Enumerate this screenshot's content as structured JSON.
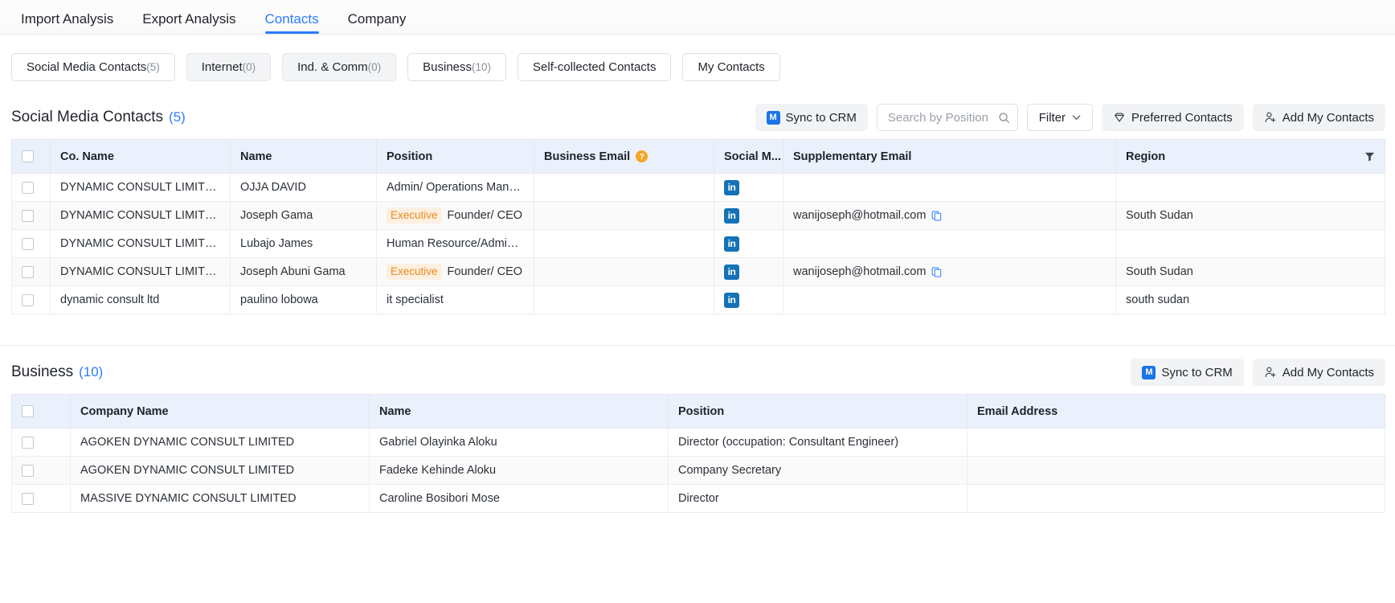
{
  "topnav": {
    "items": [
      {
        "label": "Import Analysis",
        "active": false
      },
      {
        "label": "Export Analysis",
        "active": false
      },
      {
        "label": "Contacts",
        "active": true
      },
      {
        "label": "Company",
        "active": false
      }
    ]
  },
  "chips": [
    {
      "label": "Social Media Contacts",
      "count": "(5)",
      "muted": false
    },
    {
      "label": "Internet",
      "count": "(0)",
      "muted": true
    },
    {
      "label": "Ind. & Comm",
      "count": "(0)",
      "muted": true
    },
    {
      "label": "Business",
      "count": "(10)",
      "muted": false
    },
    {
      "label": "Self-collected Contacts",
      "count": "",
      "muted": false
    },
    {
      "label": "My Contacts",
      "count": "",
      "muted": false
    }
  ],
  "social_section": {
    "title": "Social Media Contacts",
    "count": "(5)",
    "sync_label": "Sync to CRM",
    "sync_icon": "crm-icon",
    "search_placeholder": "Search by Position",
    "search_value": "",
    "search_icon": "search-icon",
    "filter_label": "Filter",
    "filter_icon": "chevron-down-icon",
    "preferred_label": "Preferred Contacts",
    "preferred_icon": "diamond-icon",
    "add_label": "Add My Contacts",
    "add_icon": "add-user-icon",
    "columns": [
      "Co. Name",
      "Name",
      "Position",
      "Business Email",
      "Social M...",
      "Supplementary Email",
      "Region"
    ],
    "business_email_help_icon": "question-icon",
    "region_filter_icon": "funnel-icon",
    "rows": [
      {
        "company": "DYNAMIC CONSULT LIMITED",
        "name": "OJJA DAVID",
        "tag": "",
        "position": "Admin/ Operations Manager",
        "business_email": "",
        "social": "linkedin-icon",
        "supplementary_email": "",
        "region": ""
      },
      {
        "company": "DYNAMIC CONSULT LIMITED",
        "name": "Joseph Gama",
        "tag": "Executive",
        "position": "Founder/ CEO",
        "business_email": "",
        "social": "linkedin-icon",
        "supplementary_email": "wanijoseph@hotmail.com",
        "region": "South Sudan"
      },
      {
        "company": "DYNAMIC CONSULT LIMITED",
        "name": "Lubajo James",
        "tag": "",
        "position": "Human Resource/Admin Of...",
        "business_email": "",
        "social": "linkedin-icon",
        "supplementary_email": "",
        "region": ""
      },
      {
        "company": "DYNAMIC CONSULT LIMITED",
        "name": "Joseph Abuni Gama",
        "tag": "Executive",
        "position": "Founder/ CEO",
        "business_email": "",
        "social": "linkedin-icon",
        "supplementary_email": "wanijoseph@hotmail.com",
        "region": "South Sudan"
      },
      {
        "company": "dynamic consult ltd",
        "name": "paulino lobowa",
        "tag": "",
        "position": "it specialist",
        "business_email": "",
        "social": "linkedin-icon",
        "supplementary_email": "",
        "region": "south sudan"
      }
    ]
  },
  "business_section": {
    "title": "Business",
    "count": "(10)",
    "sync_label": "Sync to CRM",
    "sync_icon": "crm-icon",
    "add_label": "Add My Contacts",
    "add_icon": "add-user-icon",
    "columns": [
      "Company Name",
      "Name",
      "Position",
      "Email Address"
    ],
    "rows": [
      {
        "company": "AGOKEN DYNAMIC CONSULT LIMITED",
        "name": "Gabriel Olayinka Aloku",
        "position": "Director (occupation: Consultant Engineer)",
        "email": ""
      },
      {
        "company": "AGOKEN DYNAMIC CONSULT LIMITED",
        "name": "Fadeke Kehinde Aloku",
        "position": "Company Secretary",
        "email": ""
      },
      {
        "company": "MASSIVE DYNAMIC CONSULT LIMITED",
        "name": "Caroline Bosibori Mose",
        "position": "Director",
        "email": ""
      }
    ]
  },
  "colors": {
    "accent": "#2b7cff",
    "header_bg": "#eaf0fc",
    "tag_orange": "#e88a1c",
    "linkedin": "#1572b6"
  }
}
